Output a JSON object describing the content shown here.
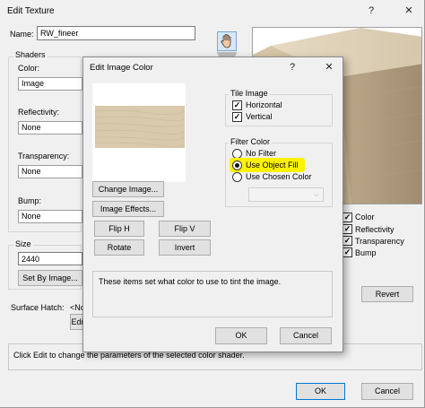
{
  "edit_texture": {
    "title": "Edit Texture",
    "help_glyph": "?",
    "close_glyph": "✕",
    "name_label": "Name:",
    "name_value": "RW_fineer",
    "shaders_label": "Shaders",
    "color_label": "Color:",
    "color_value": "Image",
    "reflectivity_label": "Reflectivity:",
    "reflectivity_value": "None",
    "transparency_label": "Transparency:",
    "transparency_value": "None",
    "bump_label": "Bump:",
    "bump_value": "None",
    "size_label": "Size",
    "size_value": "2440",
    "set_by_image_label": "Set By Image...",
    "surface_hatch_label": "Surface Hatch:",
    "surface_hatch_value": "<Non",
    "edit_button_label": "Edi",
    "checks": [
      {
        "label": "Color",
        "checked": true
      },
      {
        "label": "Reflectivity",
        "checked": true
      },
      {
        "label": "Transparency",
        "checked": true
      },
      {
        "label": "Bump",
        "checked": true
      }
    ],
    "revert_label": "Revert",
    "status_text": "Click Edit to change the parameters of the selected color shader.",
    "ok_label": "OK",
    "cancel_label": "Cancel"
  },
  "edit_image_color": {
    "title": "Edit Image Color",
    "help_glyph": "?",
    "close_glyph": "✕",
    "change_image_label": "Change Image...",
    "image_effects_label": "Image Effects...",
    "flip_h_label": "Flip H",
    "flip_v_label": "Flip V",
    "rotate_label": "Rotate",
    "invert_label": "Invert",
    "tile_image_label": "Tile Image",
    "horizontal_label": "Horizontal",
    "horizontal_checked": true,
    "vertical_label": "Vertical",
    "vertical_checked": true,
    "filter_color_label": "Filter Color",
    "filter_options": [
      "No Filter",
      "Use Object Fill",
      "Use Chosen Color"
    ],
    "filter_selected": "Use Object Fill",
    "description": "These items set what color to use to tint the image.",
    "ok_label": "OK",
    "cancel_label": "Cancel"
  },
  "colors": {
    "window_bg": "#f0f0f0",
    "highlight": "#fff200",
    "accent_border": "#0078d7",
    "wood_light": "#d9c9ad",
    "wood_mid": "#c9b898"
  },
  "icons": [
    "hand-icon",
    "close-icon",
    "help-icon",
    "dropdown-arrow-icon",
    "check-icon"
  ]
}
